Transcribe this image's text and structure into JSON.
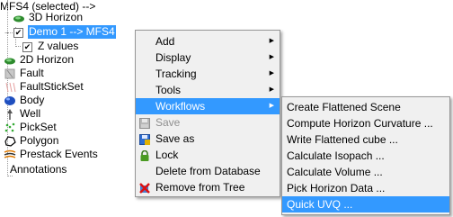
{
  "tree": {
    "items": [
      {
        "label": "3D Horizon",
        "icon": "horizon-3d-icon"
      },
      {
        "label": "Demo 1 --> MFS4",
        "icon": "checkbox-checked",
        "checked": true,
        "selected": true
      },
      {
        "label": "Z values",
        "icon": "checkbox-checked",
        "checked": true
      },
      {
        "label": "2D Horizon",
        "icon": "horizon-2d-icon"
      },
      {
        "label": "Fault",
        "icon": "fault-icon"
      },
      {
        "label": "FaultStickSet",
        "icon": "faultstickset-icon"
      },
      {
        "label": "Body",
        "icon": "body-icon"
      },
      {
        "label": "Well",
        "icon": "well-icon"
      },
      {
        "label": "PickSet",
        "icon": "pickset-icon"
      },
      {
        "label": "Polygon",
        "icon": "polygon-icon"
      },
      {
        "label": "Prestack Events",
        "icon": "prestack-events-icon"
      },
      {
        "label": "Annotations",
        "icon": ""
      }
    ]
  },
  "context_menu": {
    "items": [
      {
        "label": "Add",
        "submenu": true
      },
      {
        "label": "Display",
        "submenu": true
      },
      {
        "label": "Tracking",
        "submenu": true
      },
      {
        "label": "Tools",
        "submenu": true
      },
      {
        "label": "Workflows",
        "submenu": true,
        "highlighted": true
      },
      {
        "label": "Save",
        "disabled": true,
        "icon": "save-icon"
      },
      {
        "label": "Save as",
        "icon": "save-as-icon"
      },
      {
        "label": "Lock",
        "icon": "lock-icon"
      },
      {
        "label": "Delete from Database"
      },
      {
        "label": "Remove from Tree",
        "icon": "remove-icon"
      }
    ]
  },
  "workflows_submenu": {
    "items": [
      {
        "label": "Create Flattened Scene"
      },
      {
        "label": "Compute Horizon Curvature ..."
      },
      {
        "label": "Write Flattened cube ..."
      },
      {
        "label": "Calculate Isopach ..."
      },
      {
        "label": "Calculate Volume ..."
      },
      {
        "label": "Pick Horizon Data ..."
      },
      {
        "label": "Quick UVQ ...",
        "highlighted": true
      }
    ]
  },
  "colors": {
    "highlight": "#3399ff",
    "menu_bg": "#f0f0f0",
    "horizon_green": "#2e8b2e",
    "body_blue": "#1f4fbf"
  }
}
